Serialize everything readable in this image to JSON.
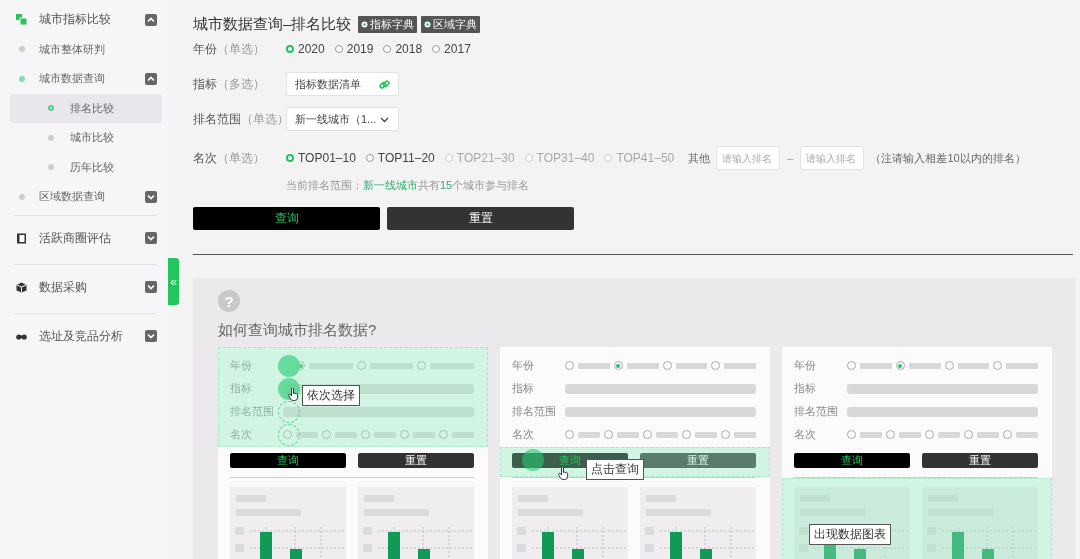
{
  "sidebar": {
    "groups": [
      {
        "label": "城市指标比较",
        "expanded": true,
        "items": [
          {
            "label": "城市整体研判",
            "active": false
          },
          {
            "label": "城市数据查询",
            "active": true,
            "expanded": true,
            "children": [
              {
                "label": "排名比较",
                "selected": true
              },
              {
                "label": "城市比较",
                "selected": false
              },
              {
                "label": "历年比较",
                "selected": false
              }
            ]
          },
          {
            "label": "区域数据查询",
            "active": false,
            "expanded": false
          }
        ]
      },
      {
        "label": "活跃商圈评估",
        "expanded": false
      },
      {
        "label": "数据采购",
        "expanded": false
      },
      {
        "label": "选址及竞品分析",
        "expanded": false
      }
    ]
  },
  "collapse_handle": "«",
  "page": {
    "title": "城市数据查询–排名比较",
    "tags": [
      "指标字典",
      "区域字典"
    ]
  },
  "form": {
    "year": {
      "label": "年份",
      "hint": "（单选）",
      "options": [
        {
          "label": "2020",
          "selected": true
        },
        {
          "label": "2019",
          "selected": false
        },
        {
          "label": "2018",
          "selected": false
        },
        {
          "label": "2017",
          "selected": false
        }
      ]
    },
    "indicator": {
      "label": "指标",
      "hint": "（多选）",
      "value": "指标数据清单"
    },
    "range": {
      "label": "排名范围",
      "hint": "（单选）",
      "value": "新一线城市（1..."
    },
    "rank": {
      "label": "名次",
      "hint": "（单选）",
      "options": [
        {
          "label": "TOP01–10",
          "selected": true,
          "disabled": false
        },
        {
          "label": "TOP11–20",
          "selected": false,
          "disabled": false
        },
        {
          "label": "TOP21–30",
          "selected": false,
          "disabled": true
        },
        {
          "label": "TOP31–40",
          "selected": false,
          "disabled": true
        },
        {
          "label": "TOP41–50",
          "selected": false,
          "disabled": true
        }
      ],
      "other_label": "其他",
      "inputs": [
        {
          "placeholder": "请输入排名"
        },
        {
          "placeholder": "请输入排名"
        }
      ],
      "separator": "–",
      "note": "（注请输入相差10以内的排名）"
    },
    "info": [
      {
        "text": "当前排名范围：",
        "highlight": false
      },
      {
        "text": "新一线城市",
        "highlight": true
      },
      {
        "text": "共有",
        "highlight": false
      },
      {
        "text": "15",
        "highlight": true
      },
      {
        "text": "个城市参与排名",
        "highlight": false
      }
    ]
  },
  "buttons": [
    {
      "label": "查询",
      "kind": "primary"
    },
    {
      "label": "重置",
      "kind": "secondary"
    }
  ],
  "guide": {
    "help_glyph": "?",
    "title": "如何查询城市排名数据?",
    "cards": [
      {
        "highlight_form": true,
        "highlight_buttons": false,
        "highlight_charts": false,
        "tooltip": "依次选择",
        "fields": [
          {
            "label": "年份",
            "kind": "radio",
            "marked": true,
            "filled": true,
            "options": [
              {
                "selected": true
              },
              {
                "selected": false
              },
              {
                "selected": false
              }
            ]
          },
          {
            "label": "指标",
            "kind": "bar",
            "marked": true,
            "filled": true
          },
          {
            "label": "排名范围",
            "kind": "bar",
            "marked": true,
            "filled": false
          },
          {
            "label": "名次",
            "kind": "radio",
            "marked": true,
            "filled": false,
            "options": [
              {
                "selected": false
              },
              {
                "selected": false
              },
              {
                "selected": false
              },
              {
                "selected": false
              },
              {
                "selected": false
              }
            ]
          }
        ],
        "buttons": [
          "查询",
          "重置"
        ]
      },
      {
        "highlight_form": false,
        "highlight_buttons": true,
        "highlight_charts": false,
        "tooltip": "点击查询",
        "fields": [
          {
            "label": "年份",
            "kind": "radio",
            "marked": false,
            "options": [
              {
                "selected": false
              },
              {
                "selected": true
              },
              {
                "selected": false
              },
              {
                "selected": false
              }
            ]
          },
          {
            "label": "指标",
            "kind": "bar",
            "marked": false
          },
          {
            "label": "排名范围",
            "kind": "bar",
            "marked": false
          },
          {
            "label": "名次",
            "kind": "radio",
            "marked": false,
            "options": [
              {
                "selected": false
              },
              {
                "selected": false
              },
              {
                "selected": false
              },
              {
                "selected": false
              },
              {
                "selected": false
              }
            ]
          }
        ],
        "buttons": [
          "查询",
          "重置"
        ]
      },
      {
        "highlight_form": false,
        "highlight_buttons": false,
        "highlight_charts": true,
        "tooltip": "出现数据图表",
        "fields": [
          {
            "label": "年份",
            "kind": "radio",
            "marked": false,
            "options": [
              {
                "selected": false
              },
              {
                "selected": true
              },
              {
                "selected": false
              },
              {
                "selected": false
              }
            ]
          },
          {
            "label": "指标",
            "kind": "bar",
            "marked": false
          },
          {
            "label": "排名范围",
            "kind": "bar",
            "marked": false
          },
          {
            "label": "名次",
            "kind": "radio",
            "marked": false,
            "options": [
              {
                "selected": false
              },
              {
                "selected": false
              },
              {
                "selected": false
              },
              {
                "selected": false
              },
              {
                "selected": false
              }
            ]
          }
        ],
        "buttons": [
          "查询",
          "重置"
        ]
      }
    ]
  }
}
